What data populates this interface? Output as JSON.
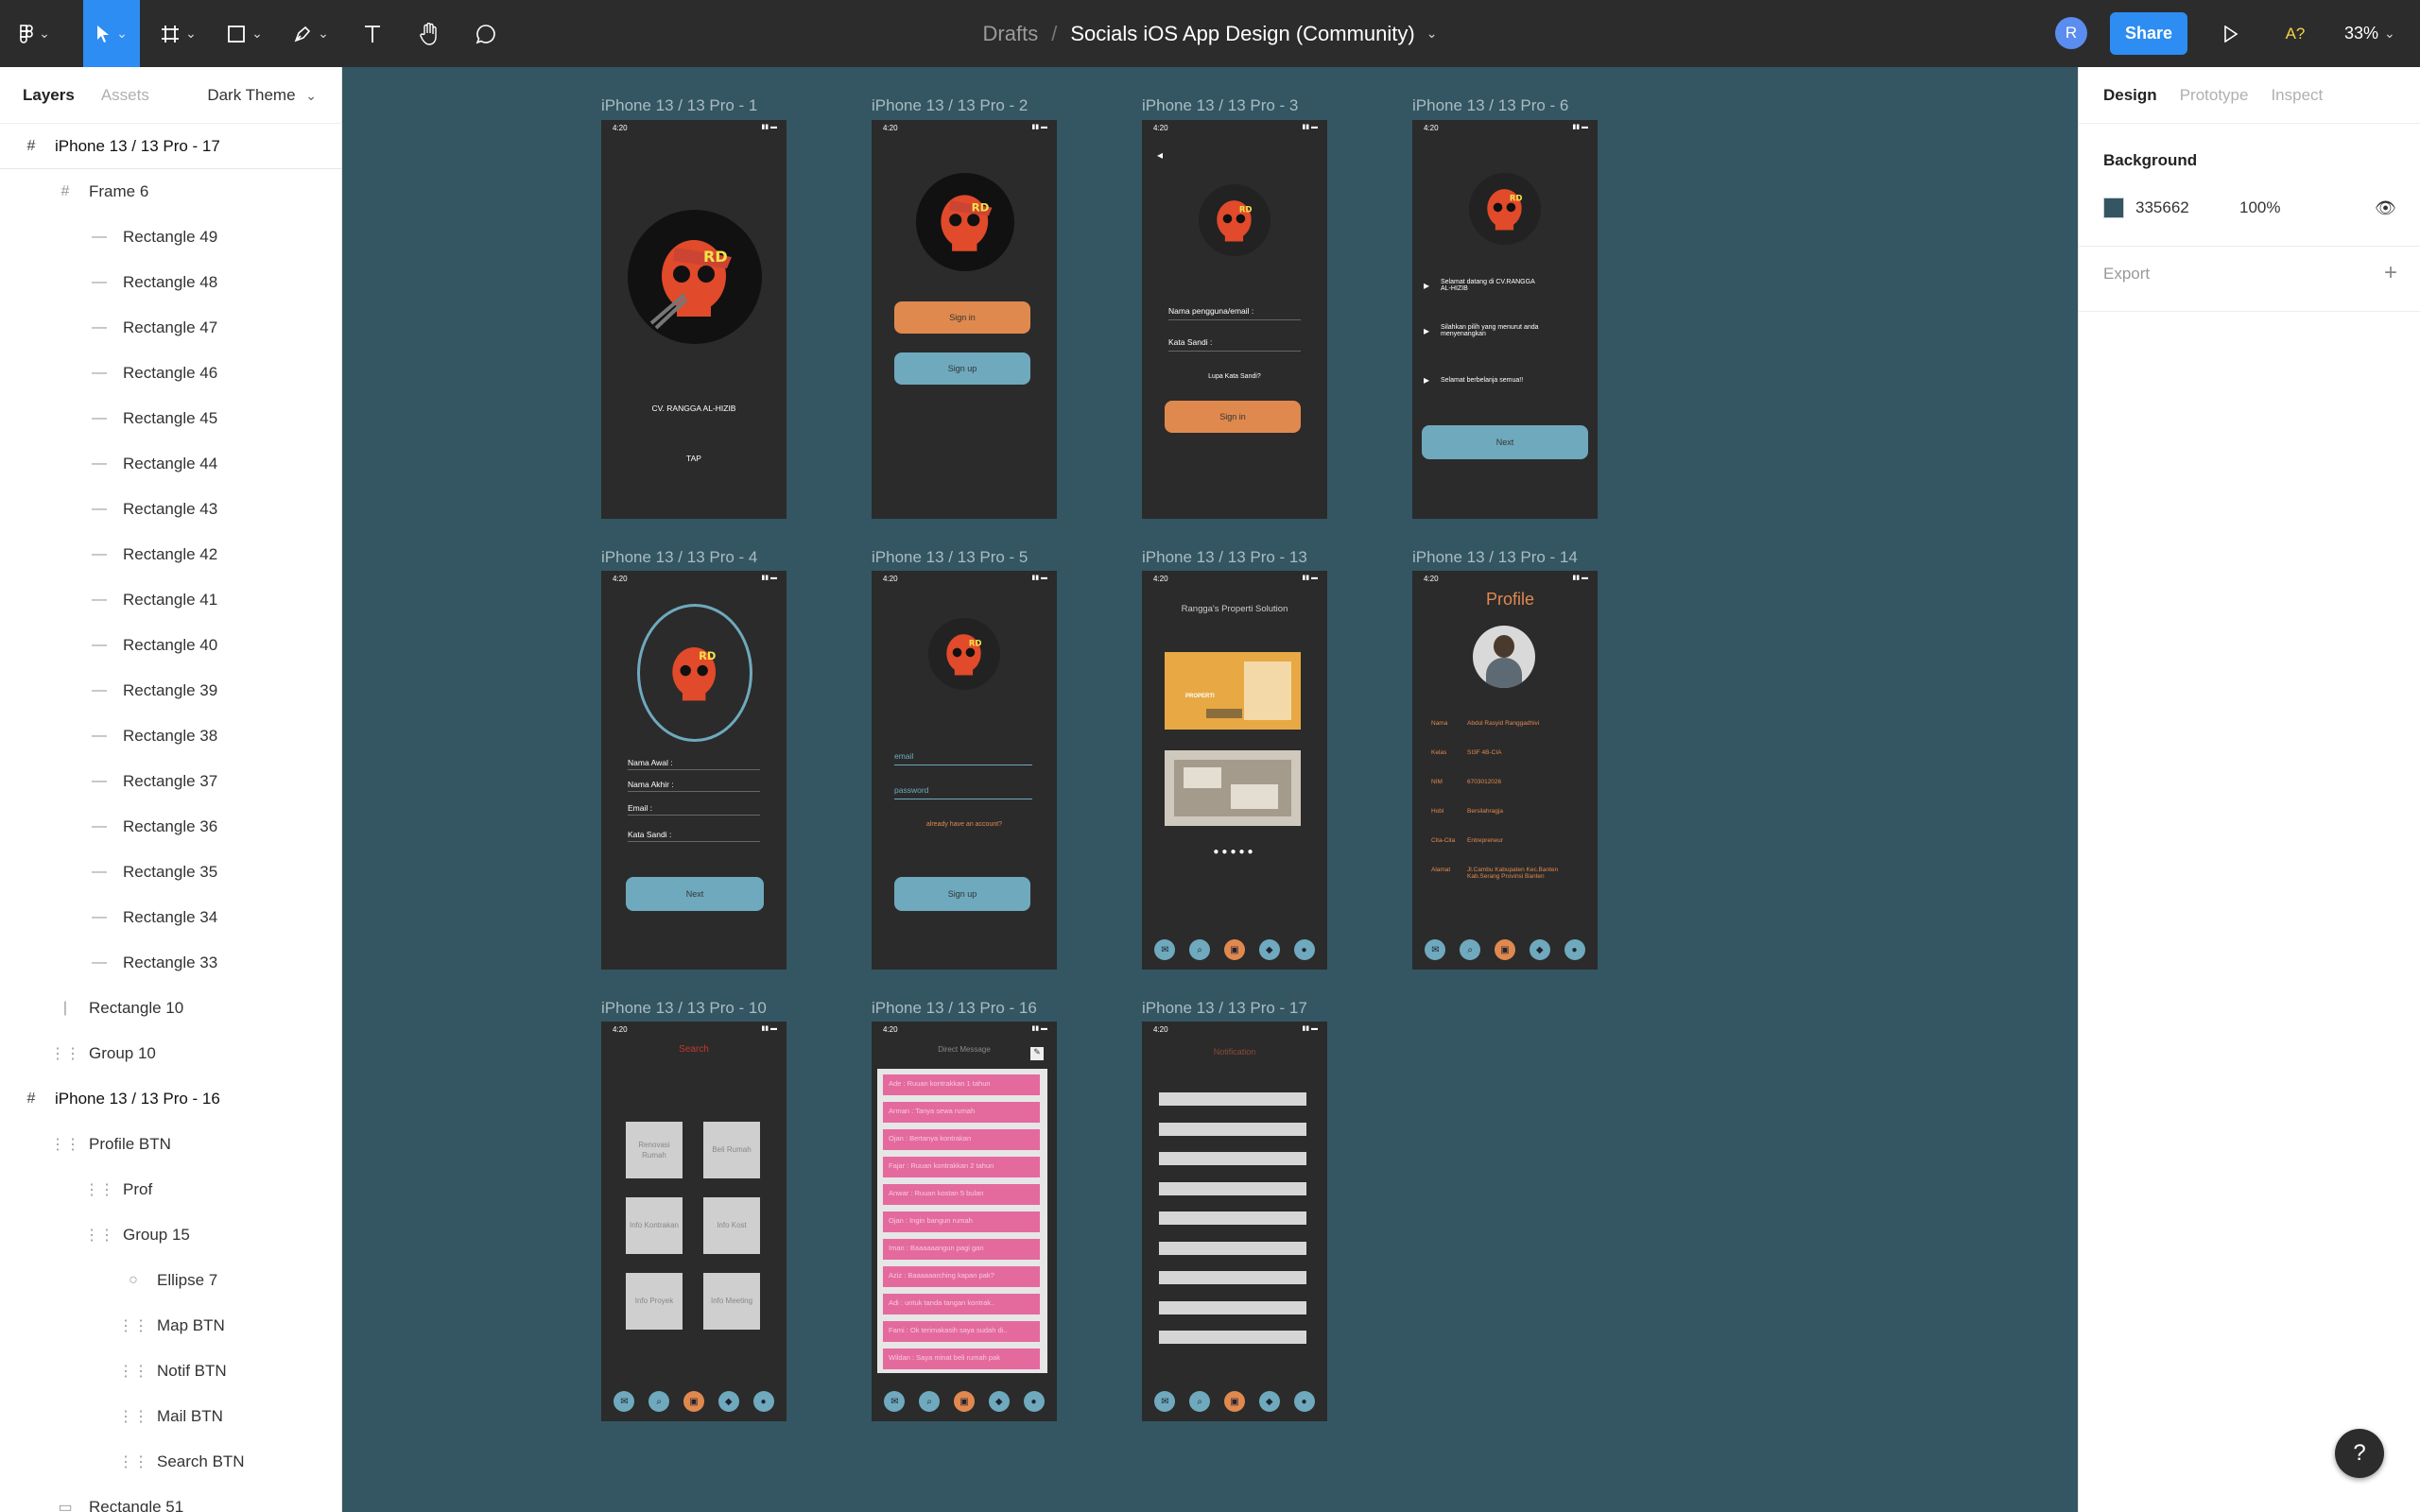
{
  "toolbar": {
    "breadcrumb": "Drafts",
    "separator": "/",
    "file_name": "Socials iOS App Design (Community)",
    "avatar_initial": "R",
    "share_label": "Share",
    "missing_fonts": "A?",
    "zoom": "33%"
  },
  "left_panel": {
    "tabs": [
      "Layers",
      "Assets"
    ],
    "theme": "Dark Theme",
    "layers": [
      {
        "label": "iPhone 13 / 13 Pro - 17",
        "type": "frame",
        "indent": 0
      },
      {
        "label": "Frame 6",
        "type": "frame-child",
        "indent": 1
      },
      {
        "label": "Rectangle 49",
        "type": "line",
        "indent": 2
      },
      {
        "label": "Rectangle 48",
        "type": "line",
        "indent": 2
      },
      {
        "label": "Rectangle 47",
        "type": "line",
        "indent": 2
      },
      {
        "label": "Rectangle 46",
        "type": "line",
        "indent": 2
      },
      {
        "label": "Rectangle 45",
        "type": "line",
        "indent": 2
      },
      {
        "label": "Rectangle 44",
        "type": "line",
        "indent": 2
      },
      {
        "label": "Rectangle 43",
        "type": "line",
        "indent": 2
      },
      {
        "label": "Rectangle 42",
        "type": "line",
        "indent": 2
      },
      {
        "label": "Rectangle 41",
        "type": "line",
        "indent": 2
      },
      {
        "label": "Rectangle 40",
        "type": "line",
        "indent": 2
      },
      {
        "label": "Rectangle 39",
        "type": "line",
        "indent": 2
      },
      {
        "label": "Rectangle 38",
        "type": "line",
        "indent": 2
      },
      {
        "label": "Rectangle 37",
        "type": "line",
        "indent": 2
      },
      {
        "label": "Rectangle 36",
        "type": "line",
        "indent": 2
      },
      {
        "label": "Rectangle 35",
        "type": "line",
        "indent": 2
      },
      {
        "label": "Rectangle 34",
        "type": "line",
        "indent": 2
      },
      {
        "label": "Rectangle 33",
        "type": "line",
        "indent": 2
      },
      {
        "label": "Rectangle 10",
        "type": "vline",
        "indent": 1
      },
      {
        "label": "Group 10",
        "type": "group",
        "indent": 1
      },
      {
        "label": "iPhone 13 / 13 Pro - 16",
        "type": "frame",
        "indent": 0
      },
      {
        "label": "Profile BTN",
        "type": "group",
        "indent": 1
      },
      {
        "label": "Prof",
        "type": "group",
        "indent": 2
      },
      {
        "label": "Group 15",
        "type": "group",
        "indent": 2
      },
      {
        "label": "Ellipse 7",
        "type": "ellipse",
        "indent": 3
      },
      {
        "label": "Map BTN",
        "type": "group",
        "indent": 3
      },
      {
        "label": "Notif BTN",
        "type": "group",
        "indent": 3
      },
      {
        "label": "Mail BTN",
        "type": "group",
        "indent": 3
      },
      {
        "label": "Search BTN",
        "type": "group",
        "indent": 3
      },
      {
        "label": "Rectangle 51",
        "type": "rect",
        "indent": 1
      }
    ]
  },
  "right_panel": {
    "tabs": [
      "Design",
      "Prototype",
      "Inspect"
    ],
    "background_label": "Background",
    "background_hex": "335662",
    "background_opacity": "100%",
    "export_label": "Export",
    "background_color": "#335662"
  },
  "frames": {
    "f1": {
      "label": "iPhone 13 / 13 Pro - 1",
      "company": "CV. RANGGA AL-HIZIB",
      "tap": "TAP"
    },
    "f2": {
      "label": "iPhone 13 / 13 Pro - 2",
      "signin": "Sign in",
      "signup": "Sign up"
    },
    "f3": {
      "label": "iPhone 13 / 13 Pro - 3",
      "user": "Nama pengguna/email :",
      "pass": "Kata Sandi :",
      "forgot": "Lupa Kata Sandi?",
      "signin": "Sign in"
    },
    "f6": {
      "label": "iPhone 13 / 13 Pro - 6",
      "m1": "Selamat datang di CV.RANGGA AL-HIZIB",
      "m2": "Silahkan pilih yang menurut anda menyenangkan",
      "m3": "Selamat berbelanja semua!!",
      "next": "Next"
    },
    "f4": {
      "label": "iPhone 13 / 13 Pro - 4",
      "first": "Nama Awal :",
      "last": "Nama Akhir :",
      "email": "Email :",
      "pass": "Kata Sandi :",
      "next": "Next"
    },
    "f5": {
      "label": "iPhone 13 / 13 Pro - 5",
      "email": "email",
      "password": "password",
      "already": "already have an account?",
      "signup": "Sign up"
    },
    "f13": {
      "label": "iPhone 13 / 13 Pro - 13",
      "title": "Rangga's Properti Solution",
      "properti": "PROPERTI"
    },
    "f14": {
      "label": "iPhone 13 / 13 Pro - 14",
      "title": "Profile",
      "rows": [
        [
          "Nama",
          "Abdul Rasyid Ranggadhivi"
        ],
        [
          "Kelas",
          "SI3F 4B-CIA"
        ],
        [
          "NIM",
          "6703012026"
        ],
        [
          "Hobi",
          "Bersilahragja"
        ],
        [
          "Cita-Cita",
          "Entrepreneur"
        ],
        [
          "Alamat",
          "Jl.Cambu Kabupaten Kec.Banten Kab.Serang Provinsi Banten"
        ]
      ]
    },
    "f10": {
      "label": "iPhone 13 / 13 Pro - 10",
      "title": "Search",
      "cards": [
        "Renovasi Rumah",
        "Beli Rumah",
        "Info Kontrakan",
        "Info Kost",
        "Info Proyek",
        "Info Meeting"
      ]
    },
    "f16": {
      "label": "iPhone 13 / 13 Pro - 16",
      "title": "Direct Message",
      "messages": [
        "Ade : Ruuan kontrakkan 1 tahun",
        "Arman : Tanya sewa rumah",
        "Ojan : Bertanya kontrakan",
        "Fajar : Ruuan kontrakkan 2 tahun",
        "Anwar : Ruuan kostan 5 bulan",
        "Ojan : Ingin bangun rumah",
        "Iman : Baaaaaangun pagi gan",
        "Aziz : Baaaaaarching kapan pak?",
        "Adi : untuk tanda tangan kontrak..",
        "Fami : Ok terimakasih saya sudah di..",
        "Wildan : Saya minat beli rumah pak"
      ]
    },
    "f17": {
      "label": "iPhone 13 / 13 Pro - 17",
      "title": "Notification"
    }
  },
  "status_time": "4:20"
}
